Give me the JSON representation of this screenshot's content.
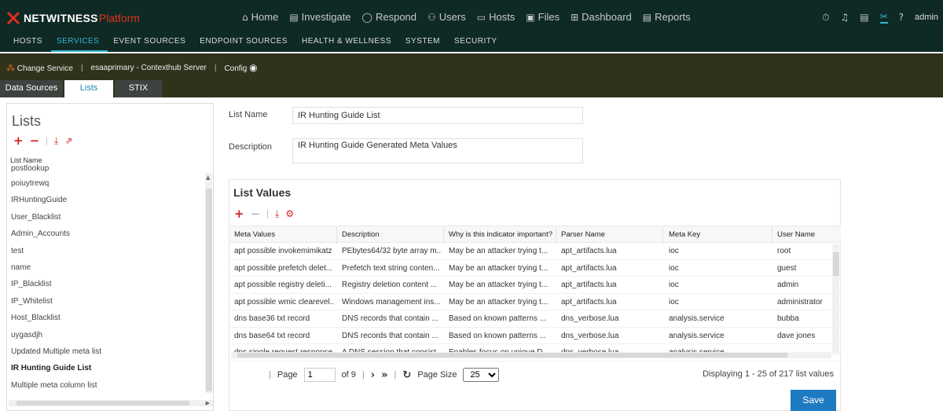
{
  "app": {
    "brand_word": "NETWITNESS",
    "brand_suffix": "Platform",
    "top_nav": [
      {
        "label": "Home",
        "icon": "home-icon"
      },
      {
        "label": "Investigate",
        "icon": "investigate-icon"
      },
      {
        "label": "Respond",
        "icon": "respond-icon"
      },
      {
        "label": "Users",
        "icon": "users-icon"
      },
      {
        "label": "Hosts",
        "icon": "hosts-icon"
      },
      {
        "label": "Files",
        "icon": "files-icon"
      },
      {
        "label": "Dashboard",
        "icon": "dashboard-icon"
      },
      {
        "label": "Reports",
        "icon": "reports-icon"
      }
    ],
    "user": "admin",
    "colors": {
      "accent": "#35b6d8",
      "dark_bg": "#0f2a24",
      "service_bg": "#30321c",
      "brand_red": "#e0301e",
      "save_blue": "#1f7bc1"
    }
  },
  "admin_nav": [
    "HOSTS",
    "SERVICES",
    "EVENT SOURCES",
    "ENDPOINT SOURCES",
    "HEALTH & WELLNESS",
    "SYSTEM",
    "SECURITY"
  ],
  "service_bar": {
    "change_service": "Change Service",
    "service_name": "esaaprimary - Contexthub Server",
    "config": "Config"
  },
  "tabs": [
    "Data Sources",
    "Lists",
    "STIX"
  ],
  "lists_panel": {
    "title": "Lists",
    "column_header": "List Name",
    "items": [
      "postlookup",
      "poiuytrewq",
      "IRHuntingGuide",
      "User_Blacklist",
      "Admin_Accounts",
      "test",
      "name",
      "IP_Blacklist",
      "IP_Whitelist",
      "Host_Blacklist",
      "uygasdjh",
      "Updated Multiple meta list",
      "IR Hunting Guide List",
      "Multiple meta column list"
    ]
  },
  "form": {
    "list_name_label": "List Name",
    "list_name_value": "IR Hunting Guide List",
    "description_label": "Description",
    "description_value": "IR Hunting Guide Generated Meta Values"
  },
  "list_values": {
    "title": "List Values",
    "columns": [
      "Meta Values",
      "Description",
      "Why is this indicator important?",
      "Parser Name",
      "Meta Key",
      "User Name"
    ],
    "rows": [
      [
        "apt possible invokemimikatz",
        "PEbytes64/32 byte array m...",
        "May be an attacker trying t...",
        "apt_artifacts.lua",
        "ioc",
        "root"
      ],
      [
        "apt possible prefetch delet...",
        "Prefetch text string conten...",
        "May be an attacker trying t...",
        "apt_artifacts.lua",
        "ioc",
        "guest"
      ],
      [
        "apt possible registry deleti...",
        "Registry deletion content ...",
        "May be an attacker trying t...",
        "apt_artifacts.lua",
        "ioc",
        "admin"
      ],
      [
        "apt possible wmic clearevel...",
        "Windows management ins...",
        "May be an attacker trying t...",
        "apt_artifacts.lua",
        "ioc",
        "administrator"
      ],
      [
        "dns base36 txt record",
        "DNS records that contain ...",
        "Based on known patterns ...",
        "dns_verbose.lua",
        "analysis.service",
        "bubba"
      ],
      [
        "dns base64 txt record",
        "DNS records that contain ...",
        "Based on known patterns ...",
        "dns_verbose.lua",
        "analysis.service",
        "dave jones"
      ],
      [
        "dns single request response",
        "A DNS session that consist...",
        "Enables focus on unique D...",
        "dns_verbose.lua",
        "analysis.service",
        ""
      ]
    ]
  },
  "pager": {
    "page_label": "Page",
    "page_value": "1",
    "of_label": "of 9",
    "page_size_label": "Page Size",
    "page_size_value": "25",
    "displaying": "Displaying 1 - 25 of 217 list values"
  },
  "save_label": "Save"
}
